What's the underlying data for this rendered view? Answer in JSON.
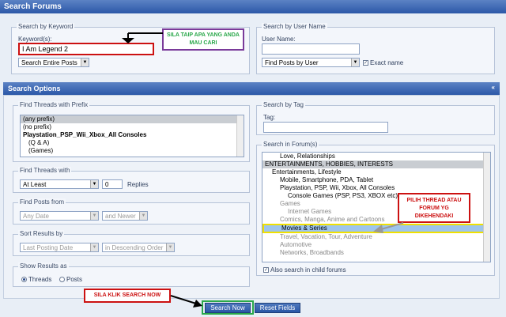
{
  "header": {
    "title": "Search Forums"
  },
  "keyword": {
    "legend": "Search by Keyword",
    "label": "Keyword(s):",
    "value": "I Am Legend 2",
    "scope": "Search Entire Posts"
  },
  "user": {
    "legend": "Search by User Name",
    "label": "User Name:",
    "value": "",
    "mode": "Find Posts by User",
    "exact_label": "Exact name"
  },
  "options_bar": {
    "title": "Search Options",
    "collapse_icon": "double-chevron-up-icon"
  },
  "prefix": {
    "legend": "Find Threads with Prefix",
    "items": [
      "(any prefix)",
      "(no prefix)",
      "Playstation_PSP_Wii_Xbox_All Consoles",
      "(Q & A)",
      "(Games)"
    ]
  },
  "replies": {
    "legend": "Find Threads with",
    "mode": "At Least",
    "count": "0",
    "suffix": "Replies"
  },
  "posts_from": {
    "legend": "Find Posts from",
    "when": "Any Date",
    "dir": "and Newer"
  },
  "sort": {
    "legend": "Sort Results by",
    "field": "Last Posting Date",
    "order": "in Descending Order"
  },
  "show": {
    "legend": "Show Results as",
    "threads": "Threads",
    "posts": "Posts"
  },
  "tag": {
    "legend": "Search by Tag",
    "label": "Tag:",
    "value": ""
  },
  "forums": {
    "legend": "Search in Forum(s)",
    "items": [
      "Love, Relationships",
      "ENTERTAINMENTS, HOBBIES, INTERESTS",
      "Entertainments, Lifestyle",
      "Mobile, Smartphone, PDA, Tablet",
      "Playstation, PSP, Wii, Xbox, All Consoles",
      "Console Games (PSP, PS3, XBOX etc)",
      "Games",
      "Internet Games",
      "Comics, Manga, Anime and Cartoons",
      "Movies & Series",
      "Travel, Vacation, Tour, Adventure",
      "Automotive",
      "Networks, Broadbands"
    ],
    "child_label": "Also search in child forums"
  },
  "buttons": {
    "search": "Search Now",
    "reset": "Reset Fields"
  },
  "notes": {
    "keyword": "SILA TAIP APA YANG ANDA MAU CARI",
    "forum": "PILIH THREAD ATAU FORUM YG DIKEHENDAKI",
    "search": "SILA KLIK SEARCH NOW"
  },
  "colors": {
    "note_red": "#cc1111",
    "note_purple": "#7a3a9a",
    "note_green": "#2aa84a",
    "note_yellow": "#f0e000",
    "accent": "#2c58a8"
  }
}
